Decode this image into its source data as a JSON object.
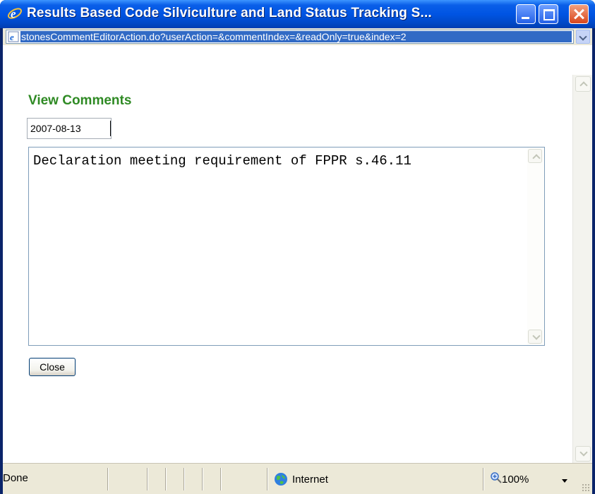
{
  "window": {
    "title": "Results Based Code Silviculture and Land Status Tracking S...",
    "controls": {
      "minimize": "minimize",
      "maximize": "maximize",
      "close": "close"
    }
  },
  "address_bar": {
    "url": "stonesCommentEditorAction.do?userAction=&commentIndex=&readOnly=true&index=2"
  },
  "page": {
    "heading": "View Comments",
    "date": "2007-08-13",
    "comment": "Declaration meeting requirement of FPPR s.46.11",
    "close_label": "Close"
  },
  "status_bar": {
    "status": "Done",
    "zone": "Internet",
    "zoom": "100%"
  },
  "colors": {
    "heading": "#2f8a24",
    "titlebar": "#0054e3",
    "url_highlight": "#316ac5"
  },
  "icons": [
    "ie-logo-icon",
    "page-icon",
    "minimize-icon",
    "maximize-icon",
    "close-icon",
    "chevron-down-icon",
    "globe-icon",
    "zoom-icon",
    "scroll-up-icon",
    "scroll-down-icon",
    "resize-grip-icon"
  ]
}
